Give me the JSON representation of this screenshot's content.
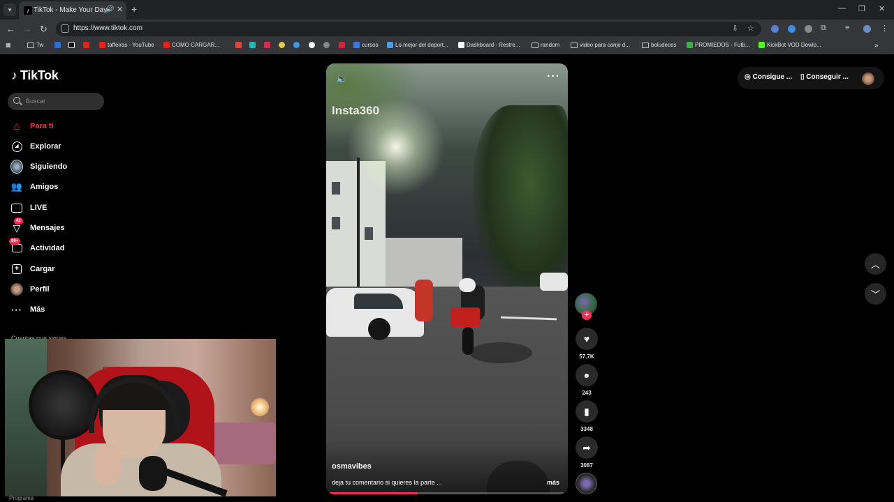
{
  "browser": {
    "tab_title": "TikTok - Make Your Day",
    "tab_favicon": "tiktok-favicon",
    "url": "https://www.tiktok.com",
    "bookmarks": [
      {
        "label": "Tw",
        "icon": "folder"
      },
      {
        "label": "",
        "icon": "app"
      },
      {
        "label": "",
        "icon": "tiktok"
      },
      {
        "label": "",
        "icon": "youtube"
      },
      {
        "label": "taffeiras - YouTube",
        "icon": "youtube"
      },
      {
        "label": "COMO CARGAR...",
        "icon": "youtube"
      },
      {
        "label": "",
        "icon": "app"
      },
      {
        "label": "",
        "icon": "app"
      },
      {
        "label": "",
        "icon": "app"
      },
      {
        "label": "",
        "icon": "app"
      },
      {
        "label": "",
        "icon": "app"
      },
      {
        "label": "",
        "icon": "app"
      },
      {
        "label": "",
        "icon": "app"
      },
      {
        "label": "",
        "icon": "app"
      },
      {
        "label": "cursos",
        "icon": "app"
      },
      {
        "label": "Lo mejor del deport...",
        "icon": "app"
      },
      {
        "label": "Dashboard - Restre...",
        "icon": "app"
      },
      {
        "label": "random",
        "icon": "folder"
      },
      {
        "label": "video para canje d...",
        "icon": "folder"
      },
      {
        "label": "boludeces",
        "icon": "folder"
      },
      {
        "label": "PROMIEDOS - Futb...",
        "icon": "app"
      },
      {
        "label": "KickBot VOD Dowlo...",
        "icon": "app"
      }
    ]
  },
  "sidebar": {
    "logo": "TikTok",
    "search_placeholder": "Buscar",
    "items": [
      {
        "label": "Para ti",
        "icon": "home-icon",
        "active": true
      },
      {
        "label": "Explorar",
        "icon": "compass-icon"
      },
      {
        "label": "Siguiendo",
        "icon": "following-avatar-icon"
      },
      {
        "label": "Amigos",
        "icon": "friends-icon"
      },
      {
        "label": "LIVE",
        "icon": "live-icon"
      },
      {
        "label": "Mensajes",
        "icon": "messages-icon",
        "badge": "42"
      },
      {
        "label": "Actividad",
        "icon": "activity-icon",
        "badge": "99+"
      },
      {
        "label": "Cargar",
        "icon": "upload-icon"
      },
      {
        "label": "Perfil",
        "icon": "profile-avatar-icon"
      },
      {
        "label": "Más",
        "icon": "more-icon"
      }
    ],
    "following_label": "Cuentas que sigues",
    "webcam_caption": "Programa"
  },
  "video": {
    "watermark": "Insta360",
    "username": "osmavibes",
    "description": "deja tu comentario si quieres la parte ...",
    "more_label": "más",
    "progress": 0.38
  },
  "actions": {
    "likes": "57.7K",
    "comments": "243",
    "saves": "3348",
    "shares": "3087"
  },
  "header": {
    "get_coins": "Consigue ...",
    "get_app": "Conseguir ..."
  },
  "colors": {
    "accent": "#fe2c55",
    "background": "#000000"
  }
}
